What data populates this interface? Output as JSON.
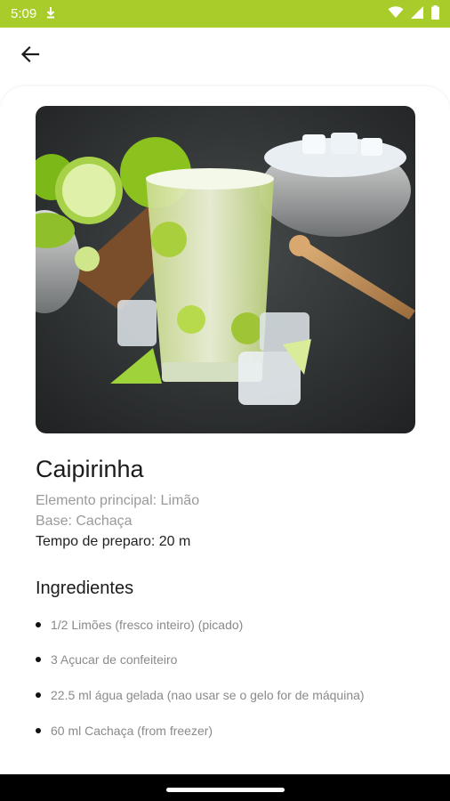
{
  "status_bar": {
    "time": "5:09",
    "bg_color": "#a8cc2a"
  },
  "app_bar": {
    "back_icon": "arrow-back-icon"
  },
  "drink": {
    "image_alt": "Caipirinha",
    "title": "Caipirinha",
    "main_element": "Elemento principal: Limão",
    "base": "Base: Cachaça",
    "prep_time": "Tempo de preparo: 20 m"
  },
  "ingredients": {
    "title": "Ingredientes",
    "items": [
      "1/2 Limões (fresco inteiro) (picado)",
      "3 Açucar de confeiteiro",
      "22.5 ml água gelada (nao usar se o gelo for de máquina)",
      "60 ml Cachaça (from freezer)"
    ]
  }
}
